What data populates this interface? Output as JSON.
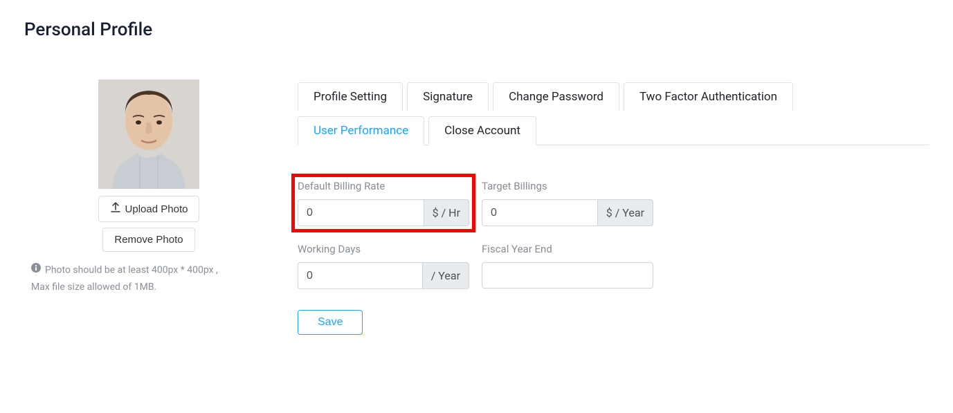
{
  "page_title": "Personal Profile",
  "photo": {
    "upload_label": "Upload Photo",
    "remove_label": "Remove Photo",
    "hint_line1": "Photo should be at least 400px * 400px ,",
    "hint_line2": "Max file size allowed of 1MB."
  },
  "tabs": [
    {
      "label": "Profile Setting",
      "active": false
    },
    {
      "label": "Signature",
      "active": false
    },
    {
      "label": "Change Password",
      "active": false
    },
    {
      "label": "Two Factor Authentication",
      "active": false
    },
    {
      "label": "User Performance",
      "active": true
    },
    {
      "label": "Close Account",
      "active": false
    }
  ],
  "form": {
    "default_billing_rate": {
      "label": "Default Billing Rate",
      "value": "0",
      "unit": "$ / Hr"
    },
    "target_billings": {
      "label": "Target Billings",
      "value": "0",
      "unit": "$ / Year"
    },
    "working_days": {
      "label": "Working Days",
      "value": "0",
      "unit": "/ Year"
    },
    "fiscal_year_end": {
      "label": "Fiscal Year End",
      "value": ""
    },
    "save_label": "Save"
  }
}
